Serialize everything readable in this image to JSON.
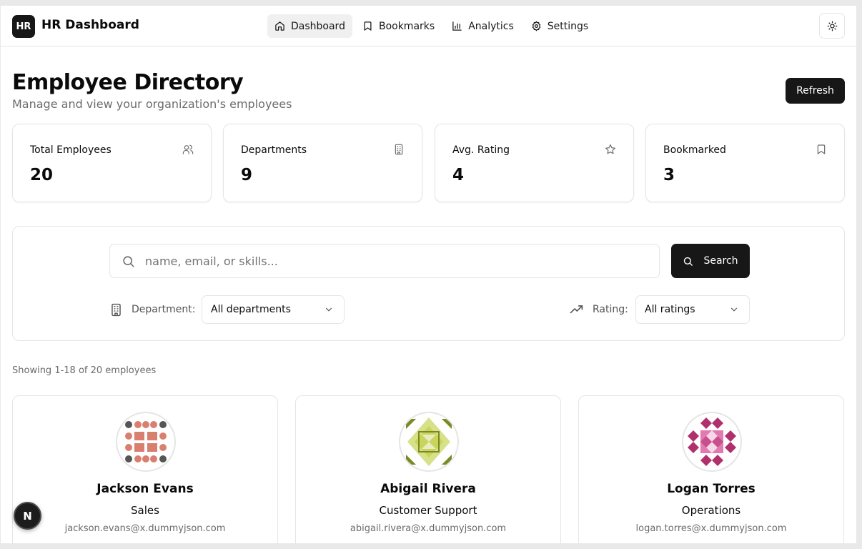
{
  "app": {
    "logo": "HR",
    "title": "HR Dashboard"
  },
  "nav": [
    {
      "label": "Dashboard",
      "icon": "home-icon",
      "active": true
    },
    {
      "label": "Bookmarks",
      "icon": "bookmark-icon",
      "active": false
    },
    {
      "label": "Analytics",
      "icon": "bar-chart-icon",
      "active": false
    },
    {
      "label": "Settings",
      "icon": "gear-icon",
      "active": false
    }
  ],
  "theme_toggle": {
    "icon": "sun-icon"
  },
  "page": {
    "title": "Employee Directory",
    "subtitle": "Manage and view your organization's employees",
    "refresh_label": "Refresh"
  },
  "stats": [
    {
      "label": "Total Employees",
      "value": "20",
      "icon": "users-icon"
    },
    {
      "label": "Departments",
      "value": "9",
      "icon": "building-icon"
    },
    {
      "label": "Avg. Rating",
      "value": "4",
      "icon": "star-icon"
    },
    {
      "label": "Bookmarked",
      "value": "3",
      "icon": "bookmark-icon"
    }
  ],
  "search": {
    "placeholder": "name, email, or skills...",
    "button_label": "Search"
  },
  "filters": {
    "department_label": "Department:",
    "department_value": "All departments",
    "rating_label": "Rating:",
    "rating_value": "All ratings"
  },
  "showing_text": "Showing 1-18 of 20 employees",
  "employees": [
    {
      "name": "Jackson Evans",
      "department": "Sales",
      "email": "jackson.evans@x.dummyjson.com",
      "avatar_colors": [
        "#d97f70",
        "#555555"
      ]
    },
    {
      "name": "Abigail Rivera",
      "department": "Customer Support",
      "email": "abigail.rivera@x.dummyjson.com",
      "avatar_colors": [
        "#c9d45c",
        "#7a8a22"
      ]
    },
    {
      "name": "Logan Torres",
      "department": "Operations",
      "email": "logan.torres@x.dummyjson.com",
      "avatar_colors": [
        "#b0306e",
        "#e07ab0"
      ]
    }
  ],
  "dev_badge": "N"
}
